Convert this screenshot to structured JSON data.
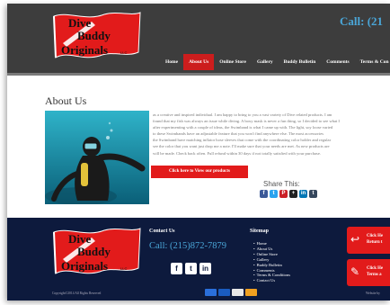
{
  "header": {
    "logo": {
      "word1": "Dive",
      "word2": "Buddy",
      "word3": "Originals",
      "suffix": "LLC"
    },
    "call_label": "Call: (21"
  },
  "nav": {
    "items": [
      {
        "label": "Home",
        "active": false
      },
      {
        "label": "About Us",
        "active": true
      },
      {
        "label": "Online Store",
        "active": false
      },
      {
        "label": "Gallery",
        "active": false
      },
      {
        "label": "Buddy Bulletin",
        "active": false
      },
      {
        "label": "Comments",
        "active": false
      },
      {
        "label": "Terms & Con",
        "active": false
      }
    ]
  },
  "about": {
    "title": "About Us",
    "paragraph_lines": [
      "as a creative and inspired individual. I am happy to bring to you a vast variety of Dive related products. I am",
      "found that my fish was always an issue while diving. A boxy mask is never a fun thing, so I decided to see what I",
      "after experimenting with a couple of ideas, the Swimband is what I came up with. The light, soy loose varied",
      "to these Swimbands have an adjustable feature that you won't find anywhere else. The most accessories",
      "the Swimband have matching inflator hose sleeves that come with the coordinating color holder and regular",
      "see the color that you want just drop me a note. I'll make sure that your needs are met. As new products are",
      "will be made. Check back often. Full refund within 30 days if not totally satisfied with your purchase."
    ],
    "cta_label": "Click here to View our products"
  },
  "share": {
    "title": "Share This:",
    "icons": [
      {
        "name": "facebook-icon",
        "glyph": "f",
        "color": "#3b5998"
      },
      {
        "name": "twitter-icon",
        "glyph": "t",
        "color": "#2aa3ef"
      },
      {
        "name": "pinterest-icon",
        "glyph": "P",
        "color": "#cb2027"
      },
      {
        "name": "plus-icon",
        "glyph": "+",
        "color": "#222222"
      },
      {
        "name": "linkedin-icon",
        "glyph": "in",
        "color": "#0077b5"
      },
      {
        "name": "tumblr-icon",
        "glyph": "t",
        "color": "#35465c"
      }
    ]
  },
  "footer": {
    "contact_heading": "Contact Us",
    "phone": "Call: (215)872-7879",
    "social": [
      {
        "name": "facebook-icon",
        "glyph": "f"
      },
      {
        "name": "twitter-icon",
        "glyph": "t"
      },
      {
        "name": "linkedin-icon",
        "glyph": "in"
      }
    ],
    "sitemap_heading": "Sitemap",
    "sitemap_items": [
      "Home",
      "About Us",
      "Online Store",
      "Gallery",
      "Buddy Bulletin",
      "Comments",
      "Terms & Conditions",
      "Contact Us"
    ],
    "side_buttons": [
      {
        "line1": "Click He",
        "line2": "Return t"
      },
      {
        "line1": "Click He",
        "line2": "Terms a"
      }
    ],
    "copyright": "Copyright©2014 All Rights Reserved",
    "website_credit": "Website by",
    "card_colors": [
      "#2a6fdb",
      "#1a5cc0",
      "#e8e8e8",
      "#f0a020"
    ]
  },
  "colors": {
    "header_bg": "#3d3d3d",
    "nav_active": "#cc1d1d",
    "accent_blue": "#4aa6d8",
    "footer_bg": "#0d1a3d",
    "cta_red": "#e21b1b"
  }
}
